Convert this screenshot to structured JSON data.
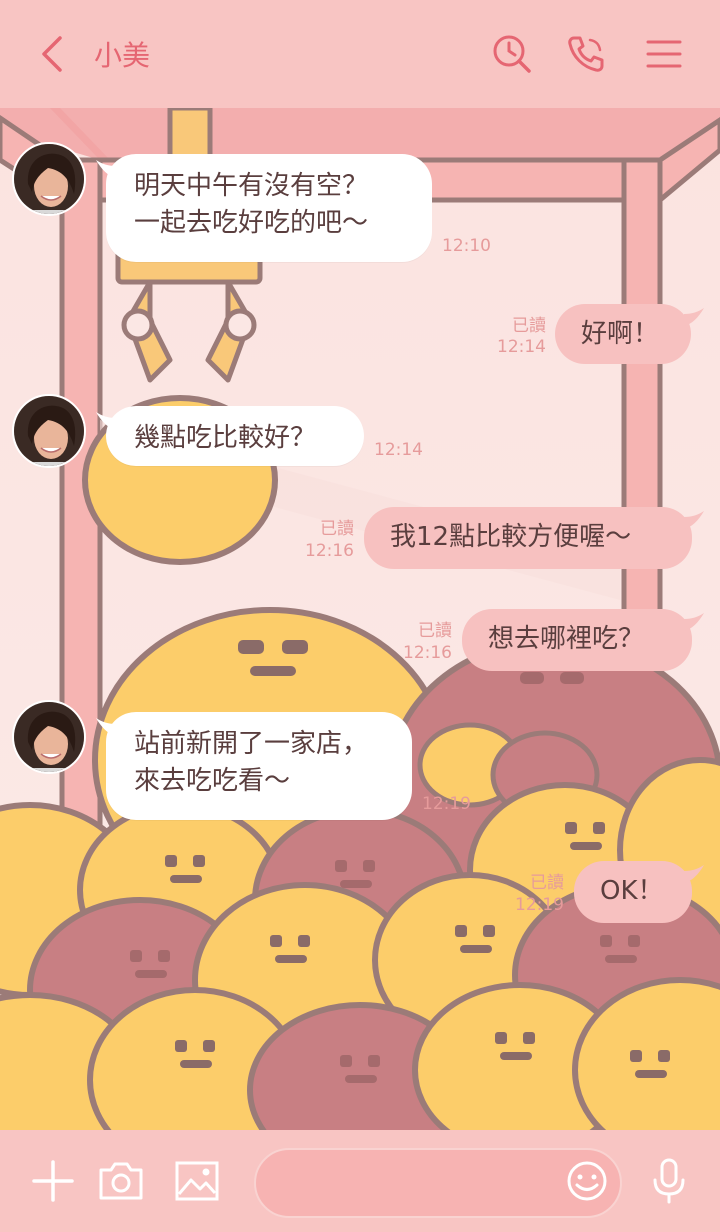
{
  "header": {
    "title": "小美",
    "icons": [
      "back-chevron-icon",
      "search-clock-icon",
      "phone-icon",
      "menu-icon"
    ]
  },
  "messages": [
    {
      "side": "in",
      "text": "明天中午有沒有空？\n一起去吃好吃的吧～",
      "time": "12:10"
    },
    {
      "side": "out",
      "text": "好啊！",
      "read": "已讀",
      "time": "12:14"
    },
    {
      "side": "in",
      "text": "幾點吃比較好？",
      "time": "12:14"
    },
    {
      "side": "out",
      "text": "我12點比較方便喔～",
      "read": "已讀",
      "time": "12:16"
    },
    {
      "side": "out",
      "text": "想去哪裡吃？",
      "read": "已讀",
      "time": "12:16"
    },
    {
      "side": "in",
      "text": "站前新開了一家店，\n來去吃吃看～",
      "time": "12:19"
    },
    {
      "side": "out",
      "text": "OK！",
      "read": "已讀",
      "time": "12:19"
    }
  ],
  "footer": {
    "icons": [
      "plus-icon",
      "camera-icon",
      "image-icon",
      "emoji-icon",
      "microphone-icon"
    ],
    "input_placeholder": ""
  },
  "colors": {
    "header_bg": "#f8c5c3",
    "accent": "#e56672",
    "bubble_in": "#ffffff",
    "bubble_out": "#f7c1c0",
    "timestamp": "#e69b9b"
  }
}
